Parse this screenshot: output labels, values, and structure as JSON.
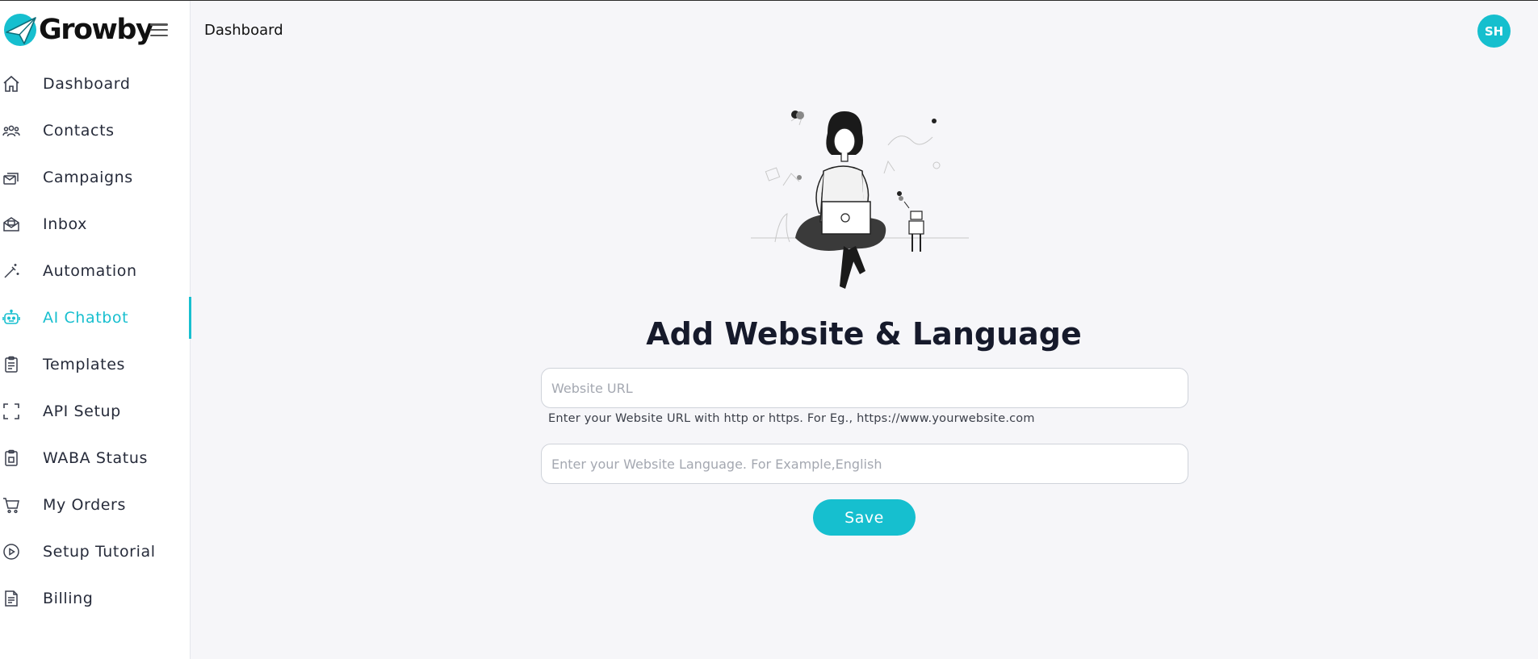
{
  "brand": {
    "name": "Growby",
    "accent": "#16bfcf"
  },
  "header": {
    "title": "Dashboard",
    "avatar_initials": "SH"
  },
  "sidebar": {
    "items": [
      {
        "label": "Dashboard",
        "icon": "home-icon"
      },
      {
        "label": "Contacts",
        "icon": "users-icon"
      },
      {
        "label": "Campaigns",
        "icon": "campaign-icon"
      },
      {
        "label": "Inbox",
        "icon": "inbox-icon"
      },
      {
        "label": "Automation",
        "icon": "magic-wand-icon"
      },
      {
        "label": "AI Chatbot",
        "icon": "robot-icon",
        "active": true
      },
      {
        "label": "Templates",
        "icon": "clipboard-icon"
      },
      {
        "label": "API Setup",
        "icon": "frame-icon"
      },
      {
        "label": "WABA Status",
        "icon": "clipboard-check-icon"
      },
      {
        "label": "My Orders",
        "icon": "cart-icon"
      },
      {
        "label": "Setup Tutorial",
        "icon": "play-circle-icon"
      },
      {
        "label": "Billing",
        "icon": "document-icon"
      }
    ]
  },
  "main": {
    "title": "Add Website & Language",
    "website_url": {
      "value": "",
      "placeholder": "Website URL"
    },
    "url_hint": "Enter your Website URL with http or https. For Eg., https://www.yourwebsite.com",
    "language": {
      "value": "",
      "placeholder": "Enter your Website Language. For Example,English"
    },
    "save_label": "Save"
  }
}
